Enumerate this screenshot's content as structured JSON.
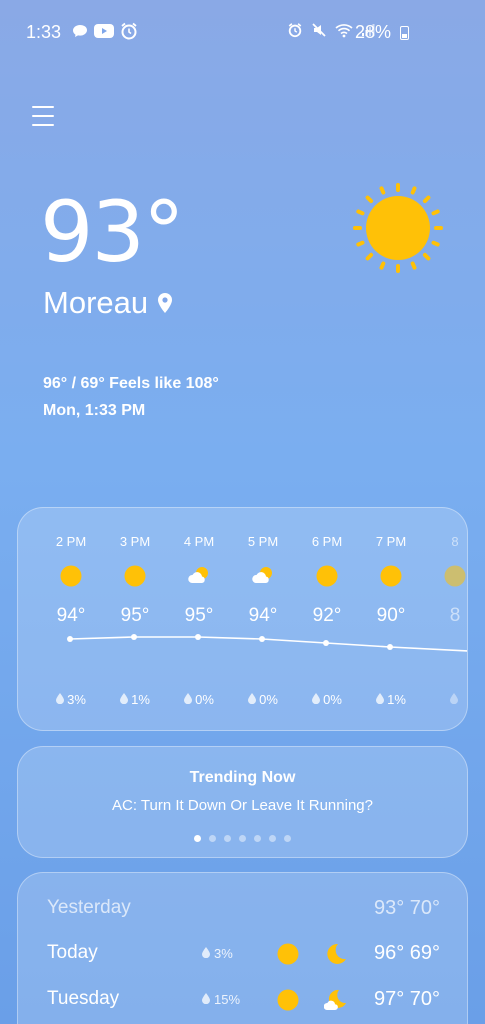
{
  "status_bar": {
    "time": "1:33",
    "battery": "28%",
    "left_icons": [
      "chat-icon",
      "youtube-icon",
      "alarm-app-icon"
    ],
    "right_icons": [
      "alarm-icon",
      "mute-icon",
      "wifi-icon",
      "signal-icon",
      "battery-icon"
    ]
  },
  "current": {
    "temperature": "93°",
    "location": "Moreau",
    "hi_lo_feels": "96° / 69° Feels like 108°",
    "datetime": "Mon, 1:33 PM",
    "icon": "sunny-icon"
  },
  "hourly": [
    {
      "time": "2 PM",
      "temp": "94°",
      "precip": "3%",
      "icon": "sunny"
    },
    {
      "time": "3 PM",
      "temp": "95°",
      "precip": "1%",
      "icon": "sunny"
    },
    {
      "time": "4 PM",
      "temp": "95°",
      "precip": "0%",
      "icon": "partly-cloudy"
    },
    {
      "time": "5 PM",
      "temp": "94°",
      "precip": "0%",
      "icon": "partly-cloudy"
    },
    {
      "time": "6 PM",
      "temp": "92°",
      "precip": "0%",
      "icon": "sunny"
    },
    {
      "time": "7 PM",
      "temp": "90°",
      "precip": "1%",
      "icon": "sunny"
    },
    {
      "time": "8",
      "temp": "8",
      "precip": "",
      "icon": "sunny"
    }
  ],
  "trending": {
    "title": "Trending Now",
    "subtitle": "AC: Turn It Down Or Leave It Running?",
    "page_count": 7,
    "active_page": 0
  },
  "daily": [
    {
      "day": "Yesterday",
      "precip": "",
      "temps": "93° 70°",
      "muted": true,
      "day_icon": "",
      "night_icon": ""
    },
    {
      "day": "Today",
      "precip": "3%",
      "temps": "96° 69°",
      "muted": false,
      "day_icon": "sunny",
      "night_icon": "moon"
    },
    {
      "day": "Tuesday",
      "precip": "15%",
      "temps": "97° 70°",
      "muted": false,
      "day_icon": "sunny",
      "night_icon": "moon-cloud"
    }
  ],
  "colors": {
    "sun": "#FFC107",
    "bg_top": "#8aa9e6",
    "bg_bottom": "#6a9fe8"
  }
}
